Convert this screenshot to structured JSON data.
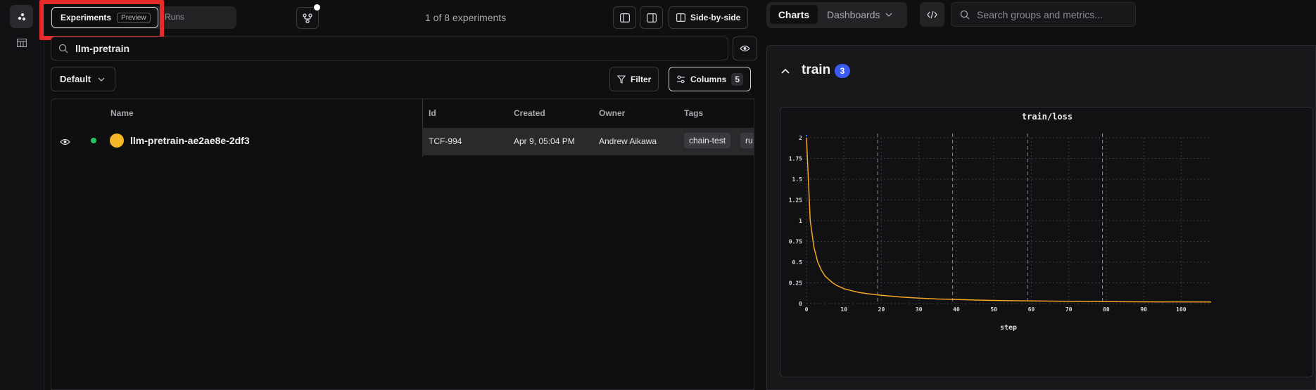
{
  "experiments_tab": {
    "label": "Experiments",
    "badge": "Preview"
  },
  "runs_tab": {
    "label": "Runs"
  },
  "header": {
    "count_text": "1 of 8 experiments",
    "side_by_side_label": "Side-by-side"
  },
  "search": {
    "value": "llm-pretrain"
  },
  "view": {
    "selected": "Default"
  },
  "toolbar": {
    "filter_label": "Filter",
    "columns_label": "Columns",
    "columns_count": "5"
  },
  "table": {
    "headers": {
      "name": "Name",
      "id": "Id",
      "created": "Created",
      "owner": "Owner",
      "tags": "Tags"
    },
    "rows": [
      {
        "name": "llm-pretrain-ae2ae8e-2df3",
        "id": "TCF-994",
        "created": "Apr 9, 05:04 PM",
        "owner": "Andrew Aikawa",
        "tags": [
          "chain-test",
          "ru"
        ],
        "status_color": "#22c55e",
        "avatar_color": "#f5b728"
      }
    ]
  },
  "right_panel": {
    "tabs": {
      "charts": "Charts",
      "dashboards": "Dashboards"
    },
    "search_placeholder": "Search groups and metrics...",
    "section": {
      "title": "train",
      "count": "3"
    }
  },
  "colors": {
    "accent": "#3b5bf0",
    "line": "#f5a623",
    "highlight": "#e62b2b"
  },
  "chart_data": {
    "type": "line",
    "title": "train/loss",
    "xlabel": "step",
    "ylabel": "",
    "xlim": [
      0,
      108
    ],
    "ylim": [
      0,
      2
    ],
    "xticks": [
      0,
      10,
      20,
      30,
      40,
      50,
      60,
      70,
      80,
      90,
      100
    ],
    "yticks": [
      0,
      0.25,
      0.5,
      0.75,
      1,
      1.25,
      1.5,
      1.75,
      2
    ],
    "ytick_labels": [
      "0",
      "0.25",
      "0.5",
      "0.75",
      "1",
      "1.25",
      "1.5",
      "1.75",
      "2"
    ],
    "grid": true,
    "marker_lines": [
      19,
      39,
      59,
      79
    ],
    "series": [
      {
        "color": "#f5a623",
        "x": [
          0,
          1,
          2,
          3,
          4,
          5,
          6,
          7,
          8,
          9,
          10,
          12,
          14,
          16,
          18,
          20,
          25,
          30,
          35,
          40,
          45,
          50,
          55,
          60,
          65,
          70,
          75,
          80,
          85,
          90,
          95,
          100,
          108
        ],
        "y": [
          2.0,
          1.0,
          0.68,
          0.5,
          0.4,
          0.33,
          0.29,
          0.25,
          0.22,
          0.2,
          0.18,
          0.155,
          0.135,
          0.12,
          0.11,
          0.1,
          0.08,
          0.065,
          0.055,
          0.05,
          0.042,
          0.038,
          0.035,
          0.032,
          0.03,
          0.028,
          0.026,
          0.025,
          0.022,
          0.021,
          0.02,
          0.02,
          0.019
        ]
      }
    ]
  }
}
